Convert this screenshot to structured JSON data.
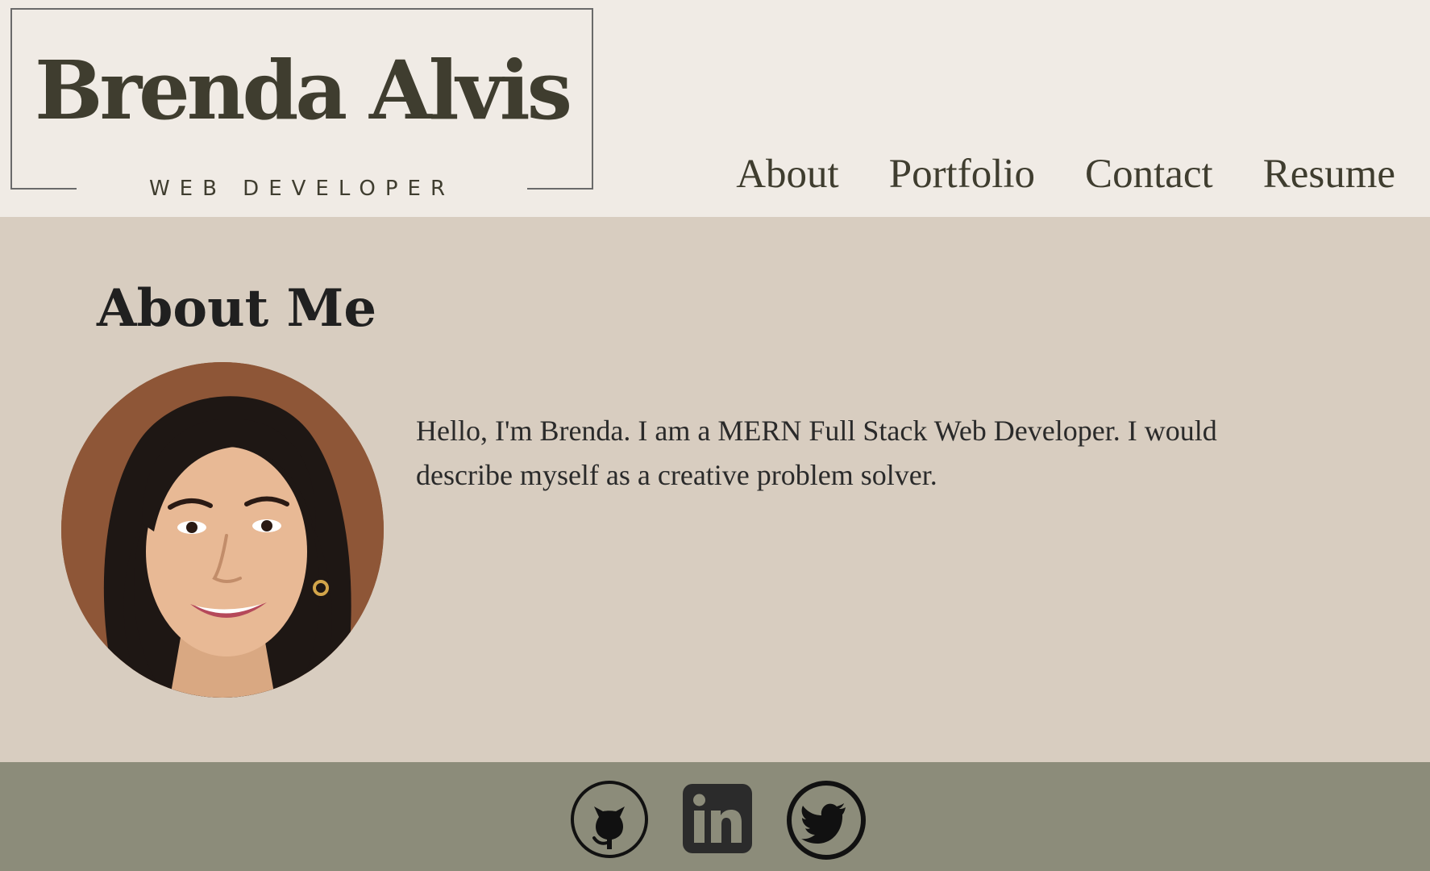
{
  "logo": {
    "name": "Brenda Alvis",
    "subtitle": "WEB DEVELOPER"
  },
  "nav": {
    "items": [
      {
        "label": "About"
      },
      {
        "label": "Portfolio"
      },
      {
        "label": "Contact"
      },
      {
        "label": "Resume"
      }
    ]
  },
  "about": {
    "title": "About Me",
    "bio": "Hello, I'm Brenda. I am a MERN Full Stack Web Developer. I would describe myself as a creative problem solver."
  },
  "footer": {
    "social": [
      {
        "icon": "github-icon"
      },
      {
        "icon": "linkedin-icon"
      },
      {
        "icon": "twitter-icon"
      }
    ]
  },
  "colors": {
    "header_bg": "#f0ebe5",
    "main_bg": "#d8cdc0",
    "footer_bg": "#8c8c7a",
    "text_dark": "#3f3d2f"
  }
}
